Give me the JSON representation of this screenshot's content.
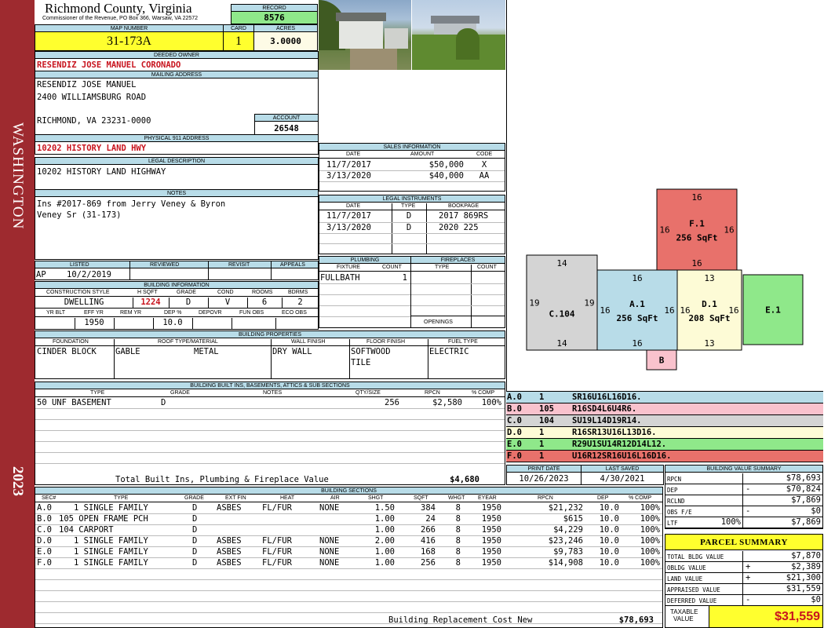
{
  "side_band": {
    "district": "WASHINGTON",
    "year": "2023"
  },
  "header": {
    "county": "Richmond County, Virginia",
    "commissioner": "Commissioner of the Revenue, PO Box 366, Warsaw, VA 22572"
  },
  "record": {
    "label": "RECORD",
    "value": "8576"
  },
  "map_number": {
    "label": "MAP NUMBER",
    "value": "31-173A"
  },
  "card": {
    "label": "CARD",
    "value": "1"
  },
  "acres": {
    "label": "ACRES",
    "value": "3.0000"
  },
  "deeded_owner": {
    "label": "DEEDED OWNER",
    "value": "RESENDIZ JOSE MANUEL CORONADO"
  },
  "mailing": {
    "label": "MAILING ADDRESS",
    "line1": "RESENDIZ JOSE MANUEL",
    "line2": "2400 WILLIAMSBURG ROAD",
    "line3": "RICHMOND, VA 23231-0000"
  },
  "account": {
    "label": "ACCOUNT",
    "value": "26548"
  },
  "physical_address": {
    "label": "PHYSICAL 911 ADDRESS",
    "value": "10202 HISTORY LAND HWY"
  },
  "legal_description": {
    "label": "LEGAL DESCRIPTION",
    "value": "10202 HISTORY LAND HIGHWAY"
  },
  "notes": {
    "label": "NOTES",
    "line1": "Ins #2017-869 from Jerry Veney & Byron",
    "line2": "Veney Sr (31-173)"
  },
  "listing": {
    "listed_label": "LISTED",
    "reviewed_label": "REVIEWED",
    "revisit_label": "REVISIT",
    "appeals_label": "APPEALS",
    "listed_code": "AP",
    "listed_date": "10/2/2019"
  },
  "building_info": {
    "label": "BUILDING INFORMATION",
    "construction_style_label": "CONSTRUCTION STYLE",
    "hsqft_label": "H SQFT",
    "grade_label": "GRADE",
    "cond_label": "COND",
    "rooms_label": "ROOMS",
    "bdrms_label": "BDRMS",
    "construction_style": "DWELLING",
    "hsqft": "1224",
    "grade": "D",
    "cond": "V",
    "rooms": "6",
    "bdrms": "2",
    "yr_blt_label": "YR BLT",
    "eff_yr_label": "EFF YR",
    "rem_yr_label": "REM YR",
    "dep_pct_label": "DEP %",
    "depovr_label": "DEPOVR",
    "fun_obs_label": "FUN OBS",
    "eco_obs_label": "ECO OBS",
    "eff_yr": "1950",
    "dep_pct": "10.0"
  },
  "sales": {
    "label": "SALES INFORMATION",
    "columns": [
      "DATE",
      "AMOUNT",
      "CODE"
    ],
    "rows": [
      {
        "date": "11/7/2017",
        "amount": "$50,000",
        "code": "X"
      },
      {
        "date": "3/13/2020",
        "amount": "$40,000",
        "code": "AA"
      }
    ]
  },
  "legal_instruments": {
    "label": "LEGAL INSTRUMENTS",
    "columns": [
      "DATE",
      "TYPE",
      "BOOKPAGE"
    ],
    "rows": [
      {
        "date": "11/7/2017",
        "type": "D",
        "bookpage": "2017 869RS"
      },
      {
        "date": "3/13/2020",
        "type": "D",
        "bookpage": "2020 225"
      }
    ]
  },
  "plumbing": {
    "label": "PLUMBING",
    "fixture_label": "FIXTURE",
    "count_label": "COUNT",
    "fixture": "FULLBATH",
    "count": "1"
  },
  "fireplaces": {
    "label": "FIREPLACES",
    "type_label": "TYPE",
    "count_label": "COUNT",
    "openings_label": "OPENINGS"
  },
  "building_properties": {
    "label": "BUILDING PROPERTIES",
    "foundation_label": "FOUNDATION",
    "roof_label": "ROOF TYPE/MATERIAL",
    "wall_label": "WALL FINISH",
    "floor_label": "FLOOR FINISH",
    "fuel_label": "FUEL TYPE",
    "foundation": "CINDER BLOCK",
    "roof_type": "GABLE",
    "roof_material": "METAL",
    "wall": "DRY WALL",
    "floor1": "SOFTWOOD",
    "floor2": "TILE",
    "fuel": "ELECTRIC"
  },
  "builtins": {
    "label": "BUILDING BUILT INS, BASEMENTS, ATTICS & SUB SECTIONS",
    "columns": [
      "TYPE",
      "GRADE",
      "NOTES",
      "QTY/SIZE",
      "RPCN",
      "% COMP"
    ],
    "rows": [
      {
        "type": "50 UNF BASEMENT",
        "grade": "D",
        "notes": "",
        "qty": "256",
        "rpcn": "$2,580",
        "comp": "100%"
      }
    ],
    "total_label": "Total Built Ins, Plumbing & Fireplace Value",
    "total_value": "$4,680"
  },
  "building_sections": {
    "label": "BUILDING SECTIONS",
    "columns": [
      "SEC#",
      "TYPE",
      "GRADE",
      "EXT FIN",
      "HEAT",
      "AIR",
      "SHGT",
      "SQFT",
      "WHGT",
      "EYEAR",
      "RPCN",
      "DEP",
      "% COMP"
    ],
    "rows": [
      {
        "sec": "A.0",
        "type": "1 SINGLE FAMILY",
        "grade": "D",
        "ext": "ASBES",
        "heat": "FL/FUR",
        "air": "NONE",
        "shgt": "1.50",
        "sqft": "384",
        "whgt": "8",
        "eyear": "1950",
        "rpcn": "$21,232",
        "dep": "10.0",
        "comp": "100%"
      },
      {
        "sec": "B.0",
        "type": "105 OPEN FRAME PCH",
        "grade": "D",
        "ext": "",
        "heat": "",
        "air": "",
        "shgt": "1.00",
        "sqft": "24",
        "whgt": "8",
        "eyear": "1950",
        "rpcn": "$615",
        "dep": "10.0",
        "comp": "100%"
      },
      {
        "sec": "C.0",
        "type": "104 CARPORT",
        "grade": "D",
        "ext": "",
        "heat": "",
        "air": "",
        "shgt": "1.00",
        "sqft": "266",
        "whgt": "8",
        "eyear": "1950",
        "rpcn": "$4,229",
        "dep": "10.0",
        "comp": "100%"
      },
      {
        "sec": "D.0",
        "type": "1 SINGLE FAMILY",
        "grade": "D",
        "ext": "ASBES",
        "heat": "FL/FUR",
        "air": "NONE",
        "shgt": "2.00",
        "sqft": "416",
        "whgt": "8",
        "eyear": "1950",
        "rpcn": "$23,246",
        "dep": "10.0",
        "comp": "100%"
      },
      {
        "sec": "E.0",
        "type": "1 SINGLE FAMILY",
        "grade": "D",
        "ext": "ASBES",
        "heat": "FL/FUR",
        "air": "NONE",
        "shgt": "1.00",
        "sqft": "168",
        "whgt": "8",
        "eyear": "1950",
        "rpcn": "$9,783",
        "dep": "10.0",
        "comp": "100%"
      },
      {
        "sec": "F.0",
        "type": "1 SINGLE FAMILY",
        "grade": "D",
        "ext": "ASBES",
        "heat": "FL/FUR",
        "air": "NONE",
        "shgt": "1.00",
        "sqft": "256",
        "whgt": "8",
        "eyear": "1950",
        "rpcn": "$14,908",
        "dep": "10.0",
        "comp": "100%"
      }
    ],
    "replacement_label": "Building Replacement Cost New",
    "replacement_value": "$78,693"
  },
  "sketch": {
    "blocks": [
      {
        "id": "F.1",
        "area": "256 SqFt",
        "top": "16",
        "bottom": "16",
        "left": "16",
        "right": "16",
        "color": "#e8716b"
      },
      {
        "id": "C.104",
        "area": "",
        "top": "14",
        "bottom": "14",
        "left": "19",
        "right": "19",
        "color": "#d4d4d4"
      },
      {
        "id": "A.1",
        "area": "256 SqFt",
        "top": "16",
        "bottom": "16",
        "left": "16",
        "right": "16",
        "color": "#b8dce8"
      },
      {
        "id": "D.1",
        "area": "208 SqFt",
        "top": "13",
        "bottom": "13",
        "left": "16",
        "right": "16",
        "color": "#fdfbd6"
      },
      {
        "id": "E.1",
        "area": "",
        "color": "#8fe88a"
      },
      {
        "id": "B",
        "area": "",
        "color": "#f9c2cd"
      }
    ]
  },
  "vectors": [
    {
      "sec": "A.0",
      "code": "1",
      "path": "SR16U16L16D16.",
      "color": "#b8dce8"
    },
    {
      "sec": "B.0",
      "code": "105",
      "path": "R16SD4L6U4R6.",
      "color": "#f9c2cd"
    },
    {
      "sec": "C.0",
      "code": "104",
      "path": "SU19L14D19R14.",
      "color": "#d4d4d4"
    },
    {
      "sec": "D.0",
      "code": "1",
      "path": "R16SR13U16L13D16.",
      "color": "#fdfbd6"
    },
    {
      "sec": "E.0",
      "code": "1",
      "path": "R29U1SU14R12D14L12.",
      "color": "#8fe88a"
    },
    {
      "sec": "F.0",
      "code": "1",
      "path": "U16R12SR16U16L16D16.",
      "color": "#e8716b"
    }
  ],
  "print_date": {
    "label": "PRINT DATE",
    "value": "10/26/2023"
  },
  "last_saved": {
    "label": "LAST SAVED",
    "value": "4/30/2021"
  },
  "building_value_summary": {
    "label": "BUILDING VALUE SUMMARY",
    "rows": [
      {
        "label": "RPCN",
        "pct": "",
        "sign": "",
        "value": "$78,693"
      },
      {
        "label": "DEP",
        "pct": "",
        "sign": "-",
        "value": "$70,824"
      },
      {
        "label": "RCLND",
        "pct": "",
        "sign": "",
        "value": "$7,869"
      },
      {
        "label": "OBS F/E",
        "pct": "",
        "sign": "-",
        "value": "$0"
      },
      {
        "label": "LTF",
        "pct": "100%",
        "sign": "",
        "value": "$7,869"
      }
    ]
  },
  "parcel_summary": {
    "title": "PARCEL SUMMARY",
    "rows": [
      {
        "label": "TOTAL BLDG VALUE",
        "sign": "",
        "value": "$7,870"
      },
      {
        "label": "OBLDG VALUE",
        "sign": "+",
        "value": "$2,389"
      },
      {
        "label": "LAND VALUE",
        "sign": "+",
        "value": "$21,300"
      },
      {
        "label": "APPRAISED VALUE",
        "sign": "",
        "value": "$31,559"
      },
      {
        "label": "DEFERRED VALUE",
        "sign": "-",
        "value": "$0"
      }
    ],
    "taxable_label_1": "TAXABLE",
    "taxable_label_2": "VALUE",
    "taxable_value": "$31,559"
  }
}
